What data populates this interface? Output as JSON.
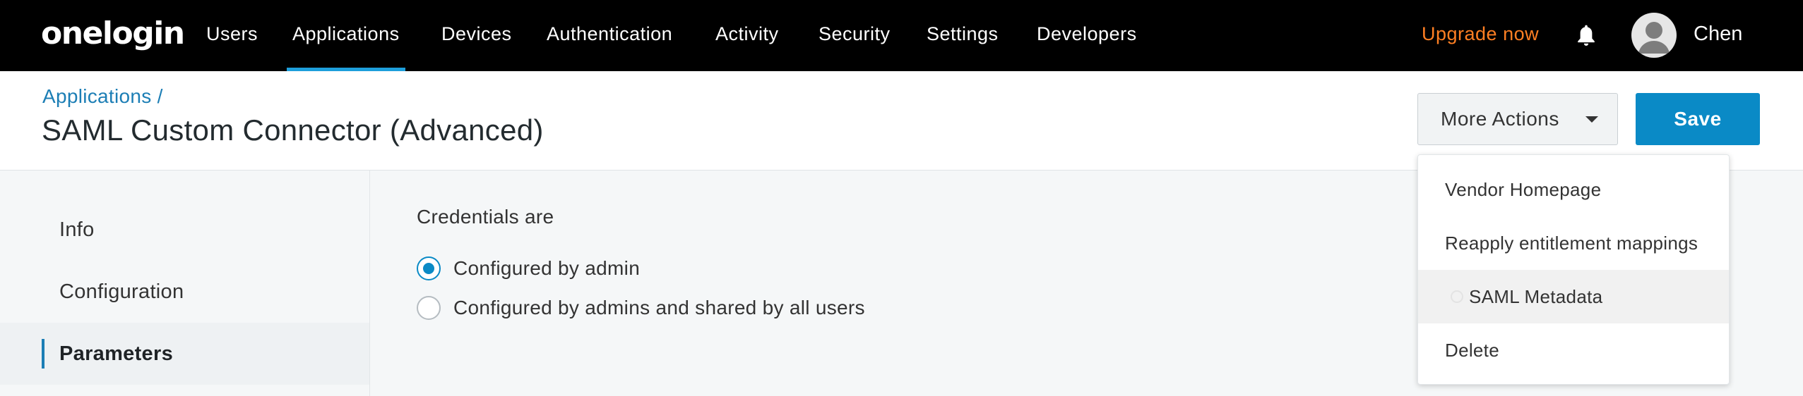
{
  "topbar": {
    "logo": "onelogin",
    "nav": [
      {
        "label": "Users",
        "name": "nav-users",
        "active": false
      },
      {
        "label": "Applications",
        "name": "nav-applications",
        "active": true
      },
      {
        "label": "Devices",
        "name": "nav-devices",
        "active": false
      },
      {
        "label": "Authentication",
        "name": "nav-authentication",
        "active": false
      },
      {
        "label": "Activity",
        "name": "nav-activity",
        "active": false
      },
      {
        "label": "Security",
        "name": "nav-security",
        "active": false
      },
      {
        "label": "Settings",
        "name": "nav-settings",
        "active": false
      },
      {
        "label": "Developers",
        "name": "nav-developers",
        "active": false
      }
    ],
    "upgrade_label": "Upgrade now",
    "user_name": "Chen"
  },
  "header": {
    "breadcrumb_link": "Applications",
    "breadcrumb_sep": " /",
    "title": "SAML Custom Connector (Advanced)",
    "more_actions_label": "More Actions",
    "save_label": "Save"
  },
  "sidebar": {
    "items": [
      {
        "label": "Info",
        "active": false
      },
      {
        "label": "Configuration",
        "active": false
      },
      {
        "label": "Parameters",
        "active": true
      }
    ]
  },
  "main": {
    "credentials_label": "Credentials are",
    "options": [
      {
        "label": "Configured by admin",
        "checked": true
      },
      {
        "label": "Configured by admins and shared by all users",
        "checked": false
      }
    ]
  },
  "dropdown": {
    "items": [
      {
        "label": "Vendor Homepage"
      },
      {
        "label": "Reapply entitlement mappings"
      },
      {
        "label": "SAML Metadata",
        "hovered": true
      },
      {
        "label": "Delete"
      }
    ]
  },
  "colors": {
    "topbar_bg": "#000000",
    "active_tab_underline": "#1e9fdb",
    "upgrade_text": "#ff7f23",
    "primary_button": "#0a8ac6",
    "link": "#1c7eb5"
  },
  "icons": [
    "bell-icon",
    "avatar-icon",
    "caret-down-icon",
    "radio-checked-icon",
    "radio-unchecked-icon",
    "loading-spinner-icon"
  ]
}
